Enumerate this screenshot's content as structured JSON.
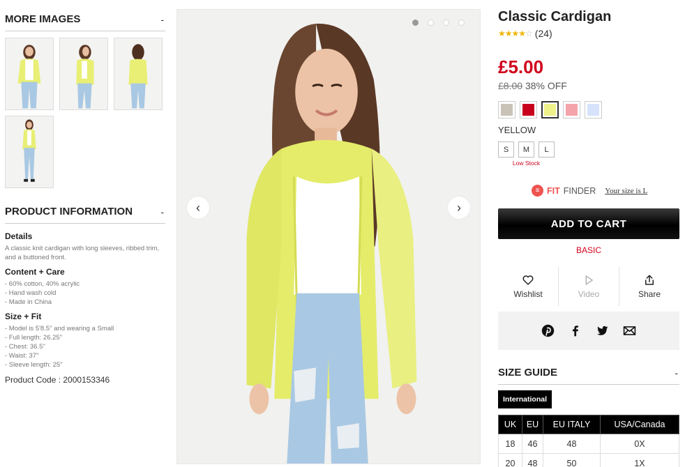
{
  "more_images": {
    "heading": "MORE IMAGES",
    "toggle": "-"
  },
  "product_info": {
    "heading": "PRODUCT INFORMATION",
    "toggle": "-",
    "details_title": "Details",
    "details_text": "A classic knit cardigan with long sleeves, ribbed trim, and a buttoned front.",
    "care_title": "Content + Care",
    "care_items": [
      "- 60% cotton, 40% acrylic",
      "- Hand wash cold",
      "- Made in China"
    ],
    "fit_title": "Size + Fit",
    "fit_items": [
      "- Model is 5'8.5\" and wearing a Small",
      "- Full length: 26.25\"",
      "- Chest: 36.5\"",
      "- Waist: 37\"",
      "- Sleeve length: 25\""
    ],
    "code_label": "Product Code : 2000153346"
  },
  "gallery": {
    "prev": "‹",
    "next": "›",
    "dots": 4,
    "active_dot": 0
  },
  "product": {
    "title": "Classic Cardigan",
    "rating_value": 4,
    "rating_count": "(24)",
    "price": "£5.00",
    "old_price": "£8.00",
    "discount": "38% OFF",
    "selected_color": "YELLOW",
    "colors": [
      {
        "name": "taupe",
        "hex": "#c9c2b6"
      },
      {
        "name": "red",
        "hex": "#c8001e"
      },
      {
        "name": "yellow",
        "hex": "#eef08a"
      },
      {
        "name": "pink",
        "hex": "#f5a3aa"
      },
      {
        "name": "light-blue",
        "hex": "#d6e3fb"
      }
    ],
    "sizes": [
      "S",
      "M",
      "L"
    ],
    "low_stock_label": "Low Stock",
    "fit_finder": {
      "logo": "≡",
      "fit": "FIT",
      "finder": "FINDER",
      "your_size": "Your size is L"
    },
    "add_to_cart": "ADD TO CART",
    "tier": "BASIC",
    "actions": {
      "wishlist": "Wishlist",
      "video": "Video",
      "share": "Share"
    }
  },
  "size_guide": {
    "heading": "SIZE GUIDE",
    "toggle": "-",
    "tab": "International",
    "columns": [
      "UK",
      "EU",
      "EU ITALY",
      "USA/Canada"
    ],
    "rows": [
      [
        "18",
        "46",
        "48",
        "0X"
      ],
      [
        "20",
        "48",
        "50",
        "1X"
      ]
    ]
  },
  "colors": {
    "accent_red": "#d0021b",
    "star": "#f0b400",
    "fit_finder": "#ef5350"
  }
}
